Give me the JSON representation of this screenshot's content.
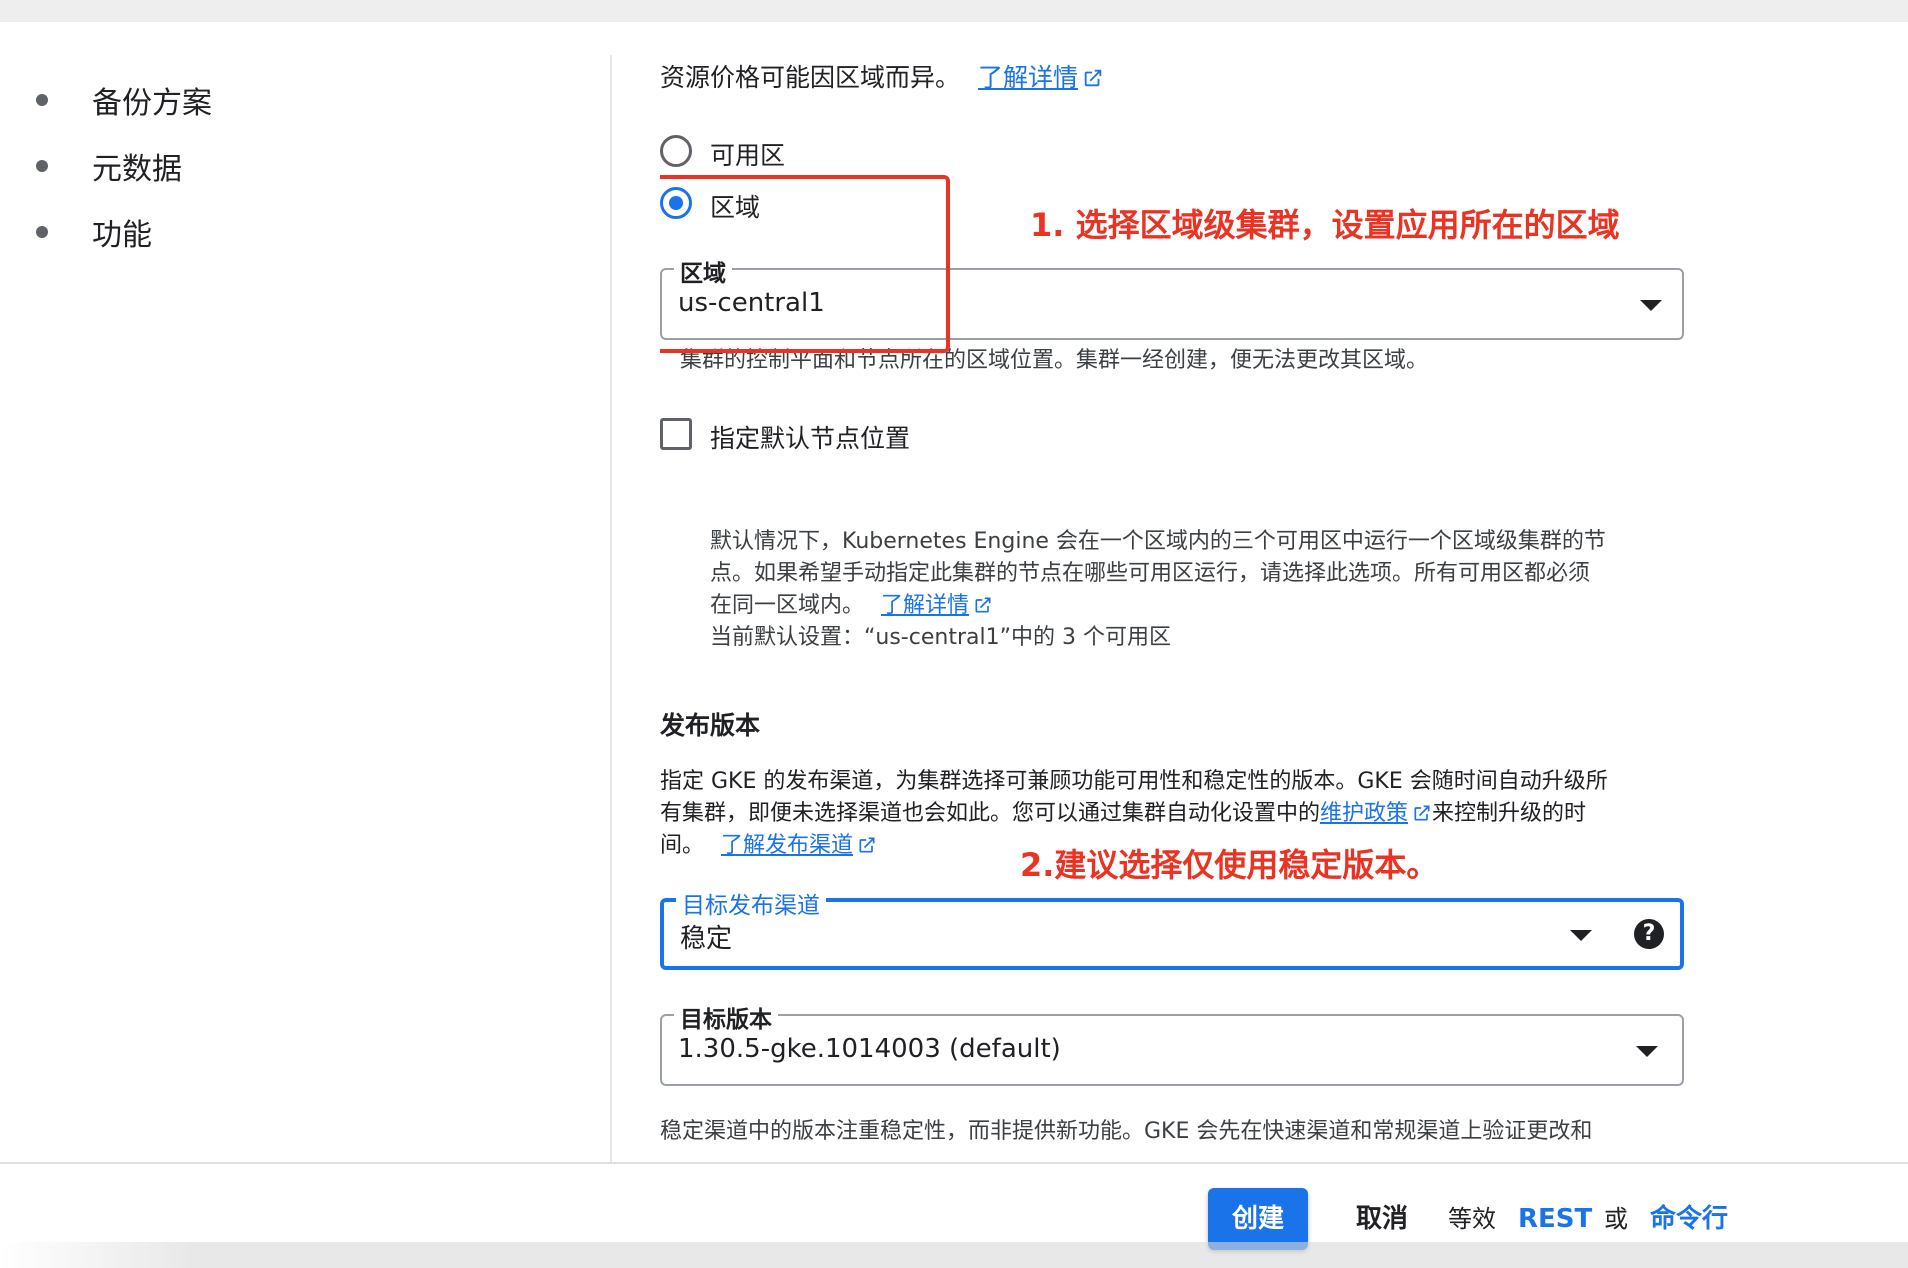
{
  "nav": {
    "items": [
      {
        "label": "备份方案"
      },
      {
        "label": "元数据"
      },
      {
        "label": "功能"
      }
    ]
  },
  "location": {
    "pricing_note": "资源价格可能因区域而异。",
    "learn_more": "了解详情",
    "radio_zonal": "可用区",
    "radio_regional": "区域",
    "region_select": {
      "label": "区域",
      "value": "us-central1"
    },
    "region_help": "集群的控制平面和节点所在的区域位置。集群一经创建，便无法更改其区域。",
    "default_nodes_checkbox": "指定默认节点位置",
    "default_nodes_desc_1": "默认情况下，Kubernetes Engine 会在一个区域内的三个可用区中运行一个区域级集群的节",
    "default_nodes_desc_2": "点。如果希望手动指定此集群的节点在哪些可用区运行，请选择此选项。所有可用区都必须",
    "default_nodes_desc_3": "在同一区域内。",
    "default_nodes_learn_more": "了解详情",
    "current_default": "当前默认设置：“us-central1”中的 3 个可用区"
  },
  "release": {
    "heading": "发布版本",
    "desc_1": "指定 GKE 的发布渠道，为集群选择可兼顾功能可用性和稳定性的版本。GKE 会随时间自动升级所",
    "desc_2_pre": "有集群，即便未选择渠道也会如此。您可以通过集群自动化设置中的",
    "desc_2_link": "维护政策",
    "desc_2_post": "来控制升级的时",
    "desc_3": "间。",
    "desc_3_link": "了解发布渠道",
    "channel_select": {
      "label": "目标发布渠道",
      "value": "稳定"
    },
    "help_icon": "?",
    "version_select": {
      "label": "目标版本",
      "value": "1.30.5-gke.1014003 (default)"
    },
    "stable_desc": "稳定渠道中的版本注重稳定性，而非提供新功能。GKE 会先在快速渠道和常规渠道上验证更改和"
  },
  "annotations": {
    "note_1": "1. 选择区域级集群，设置应用所在的区域",
    "note_2": "2.建议选择仅使用稳定版本。",
    "color": "#ea3323"
  },
  "footer": {
    "create": "创建",
    "cancel": "取消",
    "equivalent": "等效",
    "rest": "REST",
    "or": "或",
    "cli": "命令行"
  },
  "colors": {
    "accent": "#1a73e8",
    "annotation": "#ea3323"
  }
}
